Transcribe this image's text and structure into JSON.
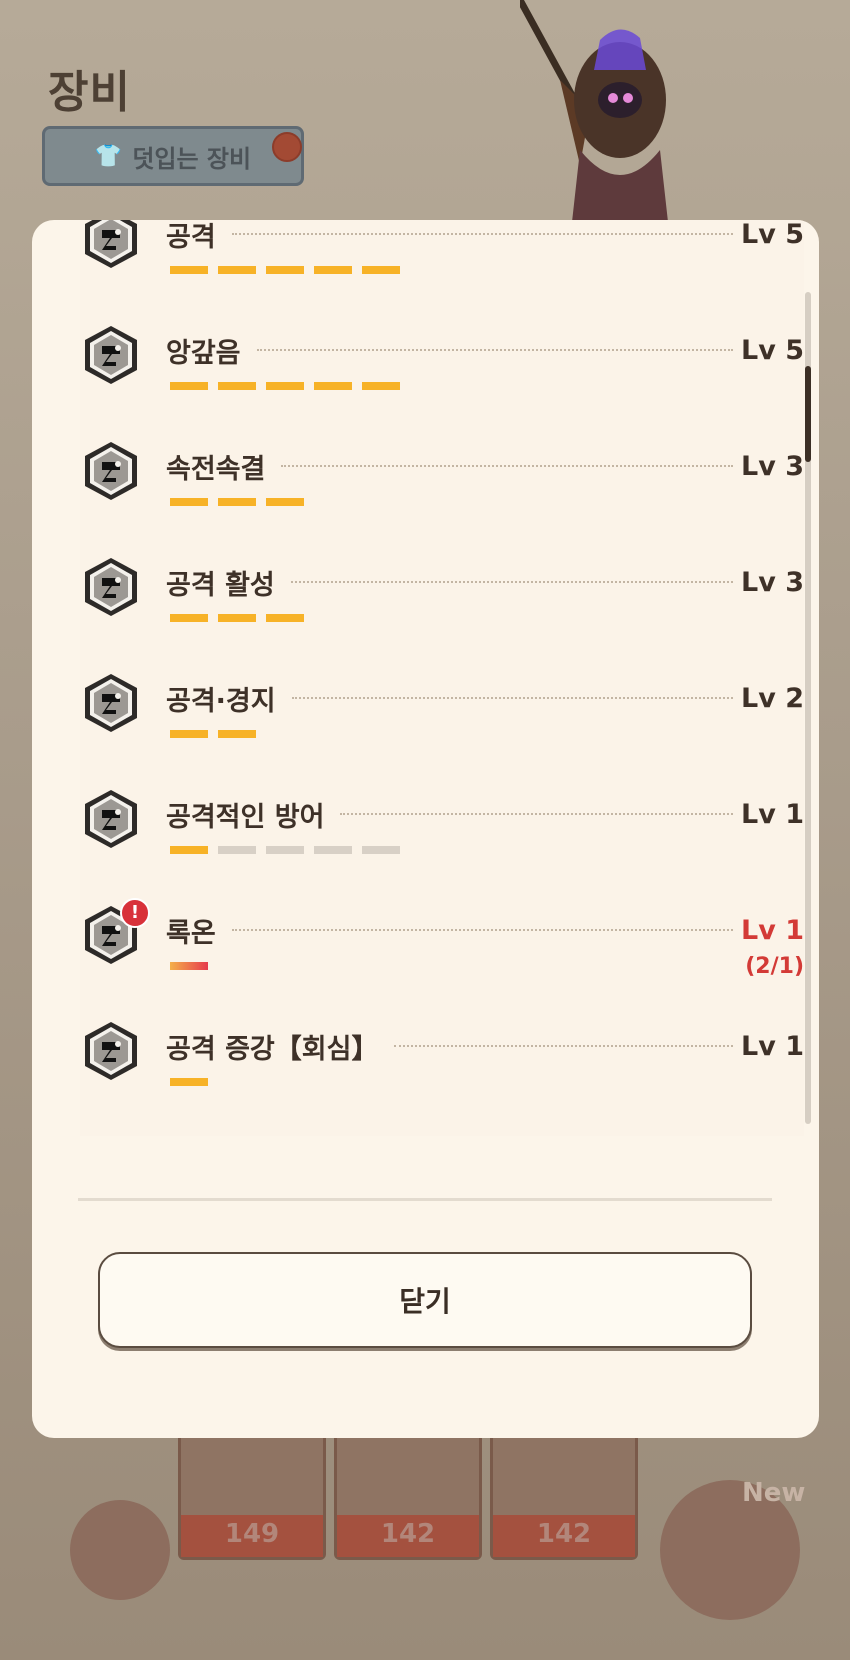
{
  "background": {
    "screen_title": "장비",
    "overlay_equipment_button": "덧입는 장비",
    "card_counts": [
      "149",
      "142",
      "142"
    ],
    "new_label": "New"
  },
  "modal": {
    "skills": [
      {
        "name": "공격",
        "level": "Lv 5",
        "bars_on": 5,
        "bars_total": 5,
        "warning": false
      },
      {
        "name": "앙갚음",
        "level": "Lv 5",
        "bars_on": 5,
        "bars_total": 5,
        "warning": false
      },
      {
        "name": "속전속결",
        "level": "Lv 3",
        "bars_on": 3,
        "bars_total": 3,
        "warning": false
      },
      {
        "name": "공격 활성",
        "level": "Lv 3",
        "bars_on": 3,
        "bars_total": 3,
        "warning": false
      },
      {
        "name": "공격·경지",
        "level": "Lv 2",
        "bars_on": 2,
        "bars_total": 2,
        "warning": false
      },
      {
        "name": "공격적인 방어",
        "level": "Lv 1",
        "bars_on": 1,
        "bars_total": 5,
        "warning": false
      },
      {
        "name": "록온",
        "level": "Lv 1",
        "sub": "(2/1)",
        "bars_on": 1,
        "bars_total": 1,
        "warning": true
      },
      {
        "name": "공격 증강【회심】",
        "level": "Lv 1",
        "bars_on": 1,
        "bars_total": 1,
        "warning": false
      }
    ],
    "close_label": "닫기"
  },
  "colors": {
    "bar_active": "#f7b227",
    "bar_inactive": "#d8d0c6",
    "warning_red": "#d33a36"
  }
}
